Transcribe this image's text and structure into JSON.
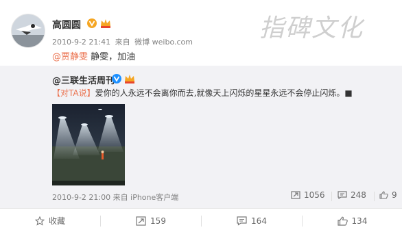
{
  "post": {
    "username": "高圆圆",
    "time": "2010-9-2 21:41",
    "source_prefix": "来自",
    "source": "微博 weibo.com",
    "mention": "@贾静雯",
    "text": " 静雯，加油"
  },
  "watermark": "指碑文化",
  "repost": {
    "author": "@三联生活周刊",
    "tag": "【对TA说】",
    "text": "爱你的人永远不会离你而去,就像天上闪烁的星星永远不会停止闪烁。■",
    "time": "2010-9-2 21:00",
    "source_prefix": "来自",
    "source": "iPhone客户端",
    "reposts": "1056",
    "comments": "248",
    "likes": "9"
  },
  "actions": {
    "favorite": "收藏",
    "repost": "159",
    "comment": "164",
    "like": "134"
  },
  "colors": {
    "accent": "#eb7350",
    "verified_badge": "#f5a623",
    "repost_bg": "#f2f2f5"
  }
}
